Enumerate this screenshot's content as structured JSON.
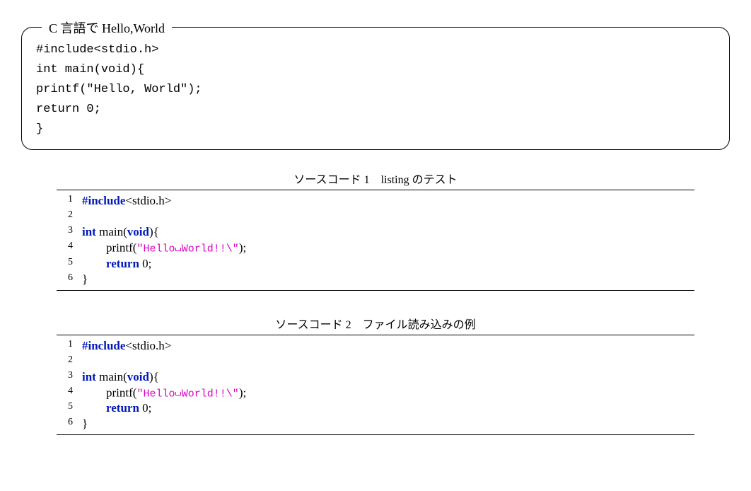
{
  "box": {
    "title": "C 言語で Hello,World",
    "lines": [
      "#include<stdio.h>",
      "int main(void){",
      "printf(\"Hello, World\");",
      "return 0;",
      "}"
    ]
  },
  "listings": [
    {
      "caption_prefix": "ソースコード 1",
      "caption_title": "listing のテスト",
      "lines": [
        [
          {
            "t": "pp",
            "v": "#include"
          },
          {
            "t": "plain",
            "v": "<stdio.h>"
          }
        ],
        [],
        [
          {
            "t": "kw",
            "v": "int"
          },
          {
            "t": "plain",
            "v": " main("
          },
          {
            "t": "kw",
            "v": "void"
          },
          {
            "t": "plain",
            "v": "){"
          }
        ],
        [
          {
            "t": "plain",
            "v": "        printf("
          },
          {
            "t": "str",
            "v": "\"Hello"
          },
          {
            "t": "vsp"
          },
          {
            "t": "str",
            "v": "World!!\\\""
          },
          {
            "t": "plain",
            "v": ");"
          }
        ],
        [
          {
            "t": "plain",
            "v": "        "
          },
          {
            "t": "kw",
            "v": "return"
          },
          {
            "t": "plain",
            "v": " 0;"
          }
        ],
        [
          {
            "t": "plain",
            "v": "}"
          }
        ]
      ]
    },
    {
      "caption_prefix": "ソースコード 2",
      "caption_title": "ファイル読み込みの例",
      "lines": [
        [
          {
            "t": "pp",
            "v": "#include"
          },
          {
            "t": "plain",
            "v": "<stdio.h>"
          }
        ],
        [],
        [
          {
            "t": "kw",
            "v": "int"
          },
          {
            "t": "plain",
            "v": " main("
          },
          {
            "t": "kw",
            "v": "void"
          },
          {
            "t": "plain",
            "v": "){"
          }
        ],
        [
          {
            "t": "plain",
            "v": "        printf("
          },
          {
            "t": "str",
            "v": "\"Hello"
          },
          {
            "t": "vsp"
          },
          {
            "t": "str",
            "v": "World!!\\\""
          },
          {
            "t": "plain",
            "v": ");"
          }
        ],
        [
          {
            "t": "plain",
            "v": "        "
          },
          {
            "t": "kw",
            "v": "return"
          },
          {
            "t": "plain",
            "v": " 0;"
          }
        ],
        [
          {
            "t": "plain",
            "v": "}"
          }
        ]
      ]
    }
  ]
}
